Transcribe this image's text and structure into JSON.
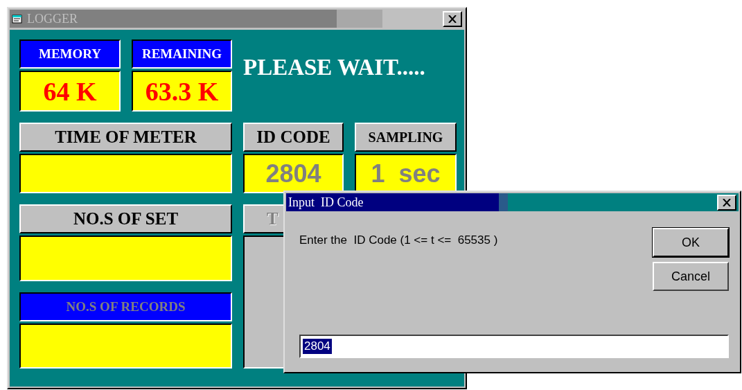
{
  "window": {
    "title": "LOGGER",
    "active": false
  },
  "status": "PLEASE WAIT.....",
  "panels": [
    {
      "label": "MEMORY",
      "kind": "counter",
      "label_disabled": false,
      "value": "64 K"
    },
    {
      "label": "REMAINING",
      "kind": "counter",
      "label_disabled": false,
      "value": "63.3 K"
    },
    {
      "label": "TIME OF METER",
      "kind": "reading",
      "label_disabled": false
    },
    {
      "label": "ID CODE",
      "kind": "reading",
      "label_disabled": false,
      "value": "2804"
    },
    {
      "label": "SAMPLING",
      "kind": "reading",
      "label_disabled": false,
      "value": "1  sec"
    },
    {
      "label": "NO.S OF SET",
      "kind": "reading",
      "label_disabled": false
    },
    {
      "label": "T",
      "kind": "list",
      "label_disabled": true
    },
    {
      "label": "NO.S OF RECORDS",
      "kind": "counter",
      "label_disabled": true
    }
  ],
  "dialog": {
    "title": "Input  ID Code",
    "active": true,
    "prompt": "Enter the  ID Code (1 <= t <=  65535 )",
    "buttons": [
      {
        "label": "OK",
        "default": true
      },
      {
        "label": "Cancel",
        "default": false
      }
    ],
    "input": {
      "value": "2804",
      "selected": true
    }
  }
}
